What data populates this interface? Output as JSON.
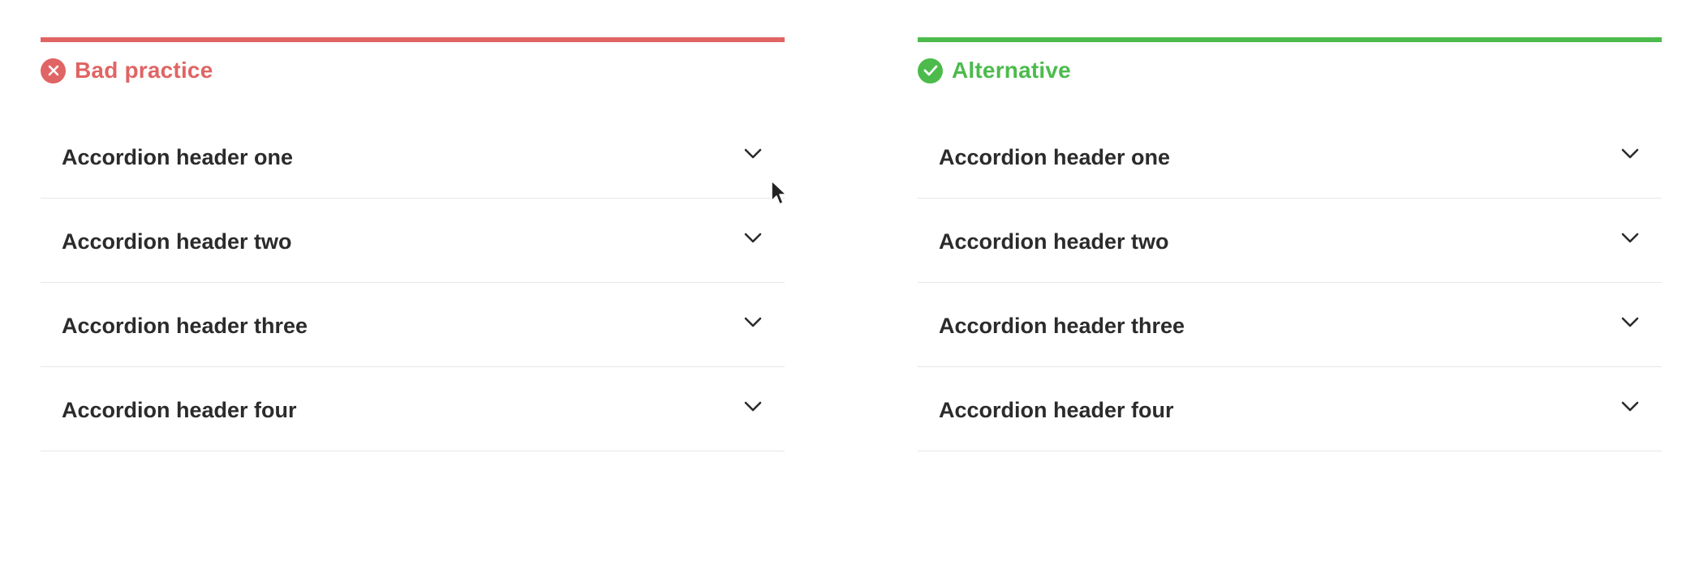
{
  "bad_panel": {
    "title": "Bad practice",
    "color": "#e06464",
    "icon": "error-x-circle-icon",
    "items": [
      {
        "label": "Accordion header one"
      },
      {
        "label": "Accordion header two"
      },
      {
        "label": "Accordion header three"
      },
      {
        "label": "Accordion header four"
      }
    ]
  },
  "good_panel": {
    "title": "Alternative",
    "color": "#4cbb4c",
    "icon": "check-circle-icon",
    "items": [
      {
        "label": "Accordion header one"
      },
      {
        "label": "Accordion header two"
      },
      {
        "label": "Accordion header three"
      },
      {
        "label": "Accordion header four"
      }
    ]
  },
  "chevron_icon": "chevron-down-icon",
  "cursor_icon": "mouse-pointer-icon"
}
